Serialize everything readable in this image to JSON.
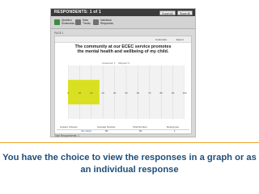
{
  "screenshot": {
    "title": "RESPONDENTS: 1 of 1",
    "buttons": [
      "Export All",
      "Share All"
    ],
    "tabs": [
      {
        "label": "Question Summaries",
        "icon": "summary-chart-icon",
        "color": "#3d8c3d"
      },
      {
        "label": "Data Trends",
        "icon": "trends-icon",
        "color": "#6f6f6f"
      },
      {
        "label": "Individual Responses",
        "icon": "person-icon",
        "color": "#6f6f6f"
      }
    ],
    "page_label": "PAGE 1",
    "card_buttons": [
      "Customize",
      "Export"
    ],
    "question": "The community at our ECEC service promotes the mental health and wellbeing of my child.",
    "legend": [
      "Answered: 1",
      "Skipped: 0"
    ],
    "table_headers": [
      "Answer Choices",
      "Average Number",
      "Total Number",
      "Responses"
    ],
    "table_row": [
      "(No label)",
      "50",
      "50",
      "1"
    ],
    "total_respondents": "Total Respondents: 1"
  },
  "chart_data": {
    "type": "bar",
    "orientation": "horizontal",
    "categories": [
      ""
    ],
    "values": [
      27
    ],
    "xlim": [
      0,
      100
    ],
    "xticks": [
      "0",
      "10",
      "20",
      "30",
      "40",
      "50",
      "60",
      "70",
      "80",
      "90",
      "100"
    ],
    "bar_color": "#d9e021",
    "grid": true
  },
  "caption": "You have the choice to view the responses in a graph or as an individual response",
  "colors": {
    "accent_rule": "#f0a326",
    "caption_text": "#1f4e79"
  }
}
